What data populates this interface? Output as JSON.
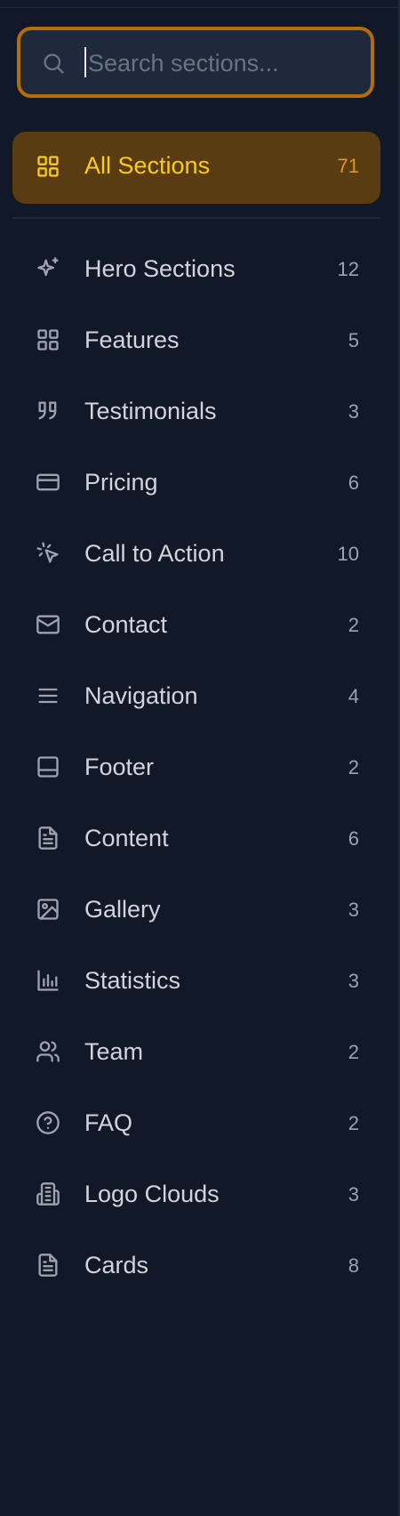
{
  "search": {
    "placeholder": "Search sections..."
  },
  "all_sections": {
    "label": "All Sections",
    "count": "71",
    "icon": "grid-icon"
  },
  "categories": [
    {
      "label": "Hero Sections",
      "count": "12",
      "icon": "sparkles-icon"
    },
    {
      "label": "Features",
      "count": "5",
      "icon": "grid-icon"
    },
    {
      "label": "Testimonials",
      "count": "3",
      "icon": "quote-icon"
    },
    {
      "label": "Pricing",
      "count": "6",
      "icon": "credit-card-icon"
    },
    {
      "label": "Call to Action",
      "count": "10",
      "icon": "cursor-click-icon"
    },
    {
      "label": "Contact",
      "count": "2",
      "icon": "mail-icon"
    },
    {
      "label": "Navigation",
      "count": "4",
      "icon": "menu-icon"
    },
    {
      "label": "Footer",
      "count": "2",
      "icon": "panel-bottom-icon"
    },
    {
      "label": "Content",
      "count": "6",
      "icon": "file-text-icon"
    },
    {
      "label": "Gallery",
      "count": "3",
      "icon": "image-icon"
    },
    {
      "label": "Statistics",
      "count": "3",
      "icon": "bar-chart-icon"
    },
    {
      "label": "Team",
      "count": "2",
      "icon": "users-icon"
    },
    {
      "label": "FAQ",
      "count": "2",
      "icon": "help-circle-icon"
    },
    {
      "label": "Logo Clouds",
      "count": "3",
      "icon": "building-icon"
    },
    {
      "label": "Cards",
      "count": "8",
      "icon": "file-text-icon"
    }
  ],
  "colors": {
    "background": "#111827",
    "search_border": "#b46d07",
    "active_bg": "#5a3c12",
    "active_text": "#facc15",
    "item_text": "#d1d5db",
    "muted": "#9ca3af"
  }
}
